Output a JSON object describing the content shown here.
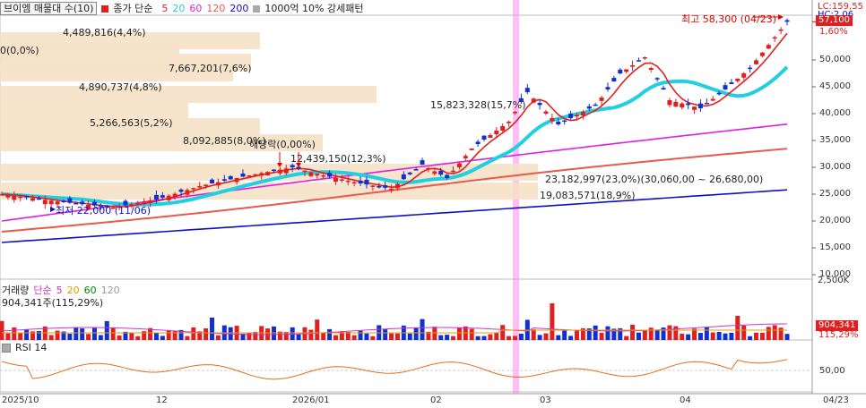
{
  "legend": {
    "title": "브이엠 매물대 수(10)",
    "close_label": "종가 단순",
    "ma_periods": [
      "5",
      "20",
      "60",
      "120",
      "200"
    ],
    "ma_colors": [
      "#e02020",
      "#22cfe0",
      "#e020e0",
      "#e85a50",
      "#1010c0"
    ],
    "pattern_label": "1000억 10% 강세패턴"
  },
  "volume_legend": {
    "title": "거래량",
    "ma_label": "단순",
    "periods": [
      "5",
      "20",
      "60",
      "120"
    ],
    "colors": [
      "#cc33cc",
      "#e0a000",
      "#008800",
      "#999999"
    ],
    "last_value": "904,341주(115,29%)"
  },
  "rsi_legend": {
    "title": "RSI 14"
  },
  "price_axis": {
    "labels": [
      "50,000",
      "45,000",
      "40,000",
      "35,000",
      "30,000",
      "25,000",
      "20,000",
      "15,000",
      "10,000"
    ]
  },
  "volume_axis": {
    "labels": [
      "2,500K",
      "50,00"
    ]
  },
  "right_badges": {
    "lc": "LC:159,55",
    "hc": "HC:2,06",
    "pct": "1,60%",
    "last_price": "57,100",
    "last_volume": "904,341",
    "last_volume_pct": "115,29%"
  },
  "x_axis": {
    "labels": [
      "2025/10",
      "12",
      "2026/01",
      "02",
      "03",
      "04",
      "04/23"
    ]
  },
  "annotations": {
    "high": "최고 58,300 (04/23)",
    "low": "최저 22,000 (11/06)",
    "flat": "해당락(0,00%)",
    "range": "23,182,997(23,0%)(30,060,00 ~ 26,680,00)"
  },
  "chart_data": {
    "type": "candlestick",
    "volume_profile": [
      {
        "label": "4,489,816(4,4%)",
        "price": 53500
      },
      {
        "label": "0(0,0%)",
        "price": 51500
      },
      {
        "label": "7,667,201(7,6%)",
        "price": 49500
      },
      {
        "label": "4,890,737(4,8%)",
        "price": 47500
      },
      {
        "label": "15,823,328(15,7%)",
        "price": 43500
      },
      {
        "label": "5,266,563(5,2%)",
        "price": 40500
      },
      {
        "label": "8,092,885(8,0%)",
        "price": 37500
      },
      {
        "label": "12,439,150(12,3%)",
        "price": 34500
      },
      {
        "label": "23,182,997(23,0%)",
        "price": 29000
      },
      {
        "label": "19,083,571(18,9%)",
        "price": 25500
      }
    ],
    "high_label": {
      "value": 58300,
      "date": "04/23"
    },
    "low_label": {
      "value": 22000,
      "date": "11/06"
    },
    "last_close": 57100,
    "ylim": [
      10000,
      60000
    ]
  }
}
